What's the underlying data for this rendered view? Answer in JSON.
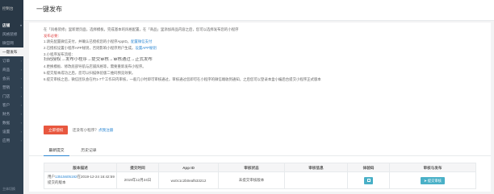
{
  "sidebar": {
    "top_label": "控制台",
    "items": [
      {
        "label": "店铺",
        "type": "section"
      },
      {
        "label": "风格装修",
        "type": "sub"
      },
      {
        "label": "微官网",
        "type": "sub"
      },
      {
        "label": "一键发布",
        "type": "active"
      },
      {
        "label": "订单",
        "type": "item"
      },
      {
        "label": "商品",
        "type": "item"
      },
      {
        "label": "会员",
        "type": "item"
      },
      {
        "label": "营销",
        "type": "item"
      },
      {
        "label": "门店",
        "type": "item"
      },
      {
        "label": "客户",
        "type": "item"
      },
      {
        "label": "财务",
        "type": "item"
      },
      {
        "label": "数据",
        "type": "item"
      },
      {
        "label": "设置",
        "type": "item"
      },
      {
        "label": "应用",
        "type": "item"
      }
    ],
    "bottom_label": "主体切换"
  },
  "header": {
    "title": "一键发布"
  },
  "notice": {
    "intro": "在「风格装修」里新建页面，选择模板，完成基本的风格配置，在「商品」里添加商品内容之后，您可以选择发布您的小程序",
    "pre_title": "发布必要：",
    "item1_text": "1.请先配置微信支付，并确认已授权您的小程序AppID。",
    "item1_link": "配置微信支付",
    "item2_text": "2.已授权设置小程序APP秘钥，否则影响小程序用户生成。",
    "item2_link": "设置APP秘钥",
    "item3_text": "3.小程序发布流程：",
    "flow": "扫码授权→发布小程序→提交审核→审核通过→正式发布",
    "item4": "4.更换模板、修改底部导航与店铺风格等，需要重新发布小程序。",
    "item5": "5.提交版本成功之后，您可以扫描体验版二维码预览效果。",
    "item6": "6.提交审核之后，微信团队会在约1-7个工作日内审核，一般几小时即可审核通过，审核通过您即可在小程序的微信端收到通知，之后您可以登录本盒小编后台提交小程序正式版本"
  },
  "auth": {
    "button": "立即授权",
    "question": "还没有小程序？",
    "question_link": "点我注册"
  },
  "tabs": [
    {
      "label": "最新提交"
    },
    {
      "label": "历史记录"
    }
  ],
  "table": {
    "headers": [
      "版本描述",
      "提交时间",
      "App ID",
      "审核状态",
      "审核信息",
      "体验码",
      "审核与发布"
    ],
    "row": {
      "desc_prefix": "用户",
      "desc_user": "13515605192",
      "desc_suffix": "在2019-12-24 16:42:59提交的版本",
      "time": "2019年12月24日",
      "appid": "wx0c1c2b0eaf533212",
      "status": "未提交审核版本",
      "info": "",
      "submit_label": "提交审核"
    }
  },
  "colors": {
    "accent": "#2c87d3",
    "danger": "#e8573f",
    "teal": "#49b0c7",
    "sidebar": "#2f4050"
  }
}
